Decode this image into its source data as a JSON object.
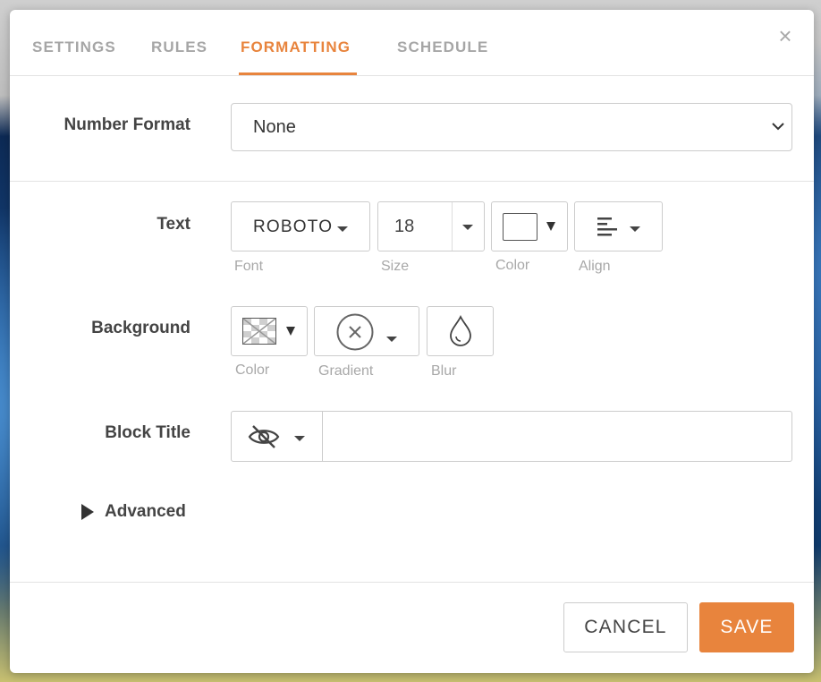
{
  "tabs": [
    {
      "label": "SETTINGS"
    },
    {
      "label": "RULES"
    },
    {
      "label": "FORMATTING"
    },
    {
      "label": "SCHEDULE"
    }
  ],
  "active_tab": "FORMATTING",
  "close_label": "×",
  "number_format": {
    "label": "Number Format",
    "value": "None"
  },
  "text": {
    "label": "Text",
    "font": {
      "value": "ROBOTO",
      "caption": "Font"
    },
    "size": {
      "value": "18",
      "caption": "Size"
    },
    "color": {
      "caption": "Color",
      "swatch": "#ffffff"
    },
    "align": {
      "caption": "Align",
      "icon": "align-left-icon"
    }
  },
  "background": {
    "label": "Background",
    "color": {
      "caption": "Color",
      "icon": "transparent-swatch-icon"
    },
    "gradient": {
      "caption": "Gradient",
      "icon": "circle-x-icon"
    },
    "blur": {
      "caption": "Blur",
      "icon": "droplet-icon"
    }
  },
  "block_title": {
    "label": "Block Title",
    "visibility_icon": "eye-off-icon",
    "value": ""
  },
  "advanced": {
    "label": "Advanced"
  },
  "footer": {
    "cancel": "CANCEL",
    "save": "SAVE"
  },
  "colors": {
    "accent": "#e8843d",
    "tab_inactive": "#a6a6a6",
    "label": "#444444",
    "caption": "#a8a8a8"
  }
}
